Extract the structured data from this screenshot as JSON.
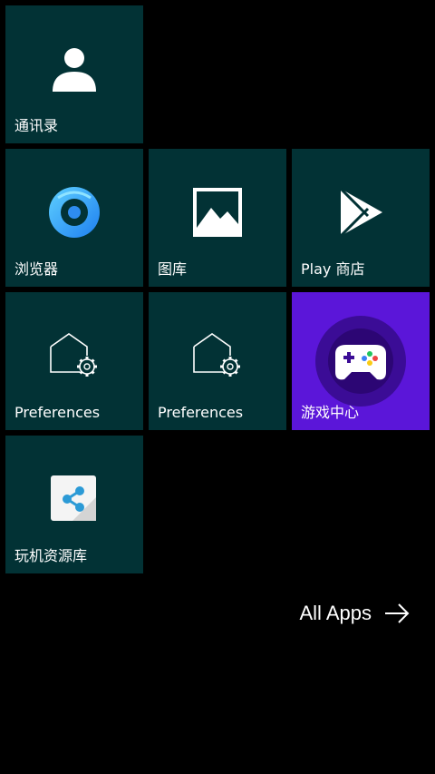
{
  "colors": {
    "background": "#000000",
    "tile": "#023235",
    "tile_accent": "#5b16d9",
    "text": "#ffffff"
  },
  "tiles": [
    {
      "label": "通讯录",
      "icon": "contact-person-icon"
    },
    {
      "label": "浏览器",
      "icon": "browser-icon"
    },
    {
      "label": "图库",
      "icon": "gallery-icon"
    },
    {
      "label": "Play 商店",
      "icon": "play-store-icon"
    },
    {
      "label": "Preferences",
      "icon": "house-gear-icon"
    },
    {
      "label": "Preferences",
      "icon": "house-gear-icon"
    },
    {
      "label": "游戏中心",
      "icon": "gamepad-icon"
    },
    {
      "label": "玩机资源库",
      "icon": "share-document-icon"
    }
  ],
  "all_apps": {
    "label": "All Apps",
    "icon": "arrow-right-icon"
  }
}
